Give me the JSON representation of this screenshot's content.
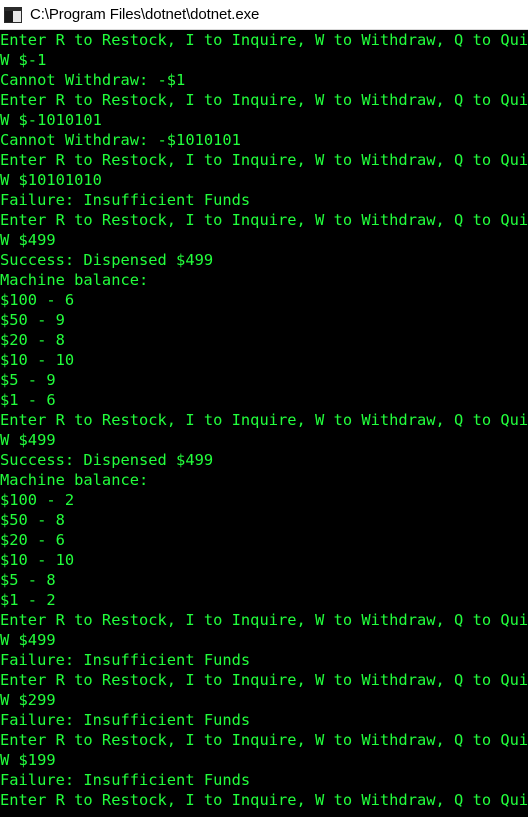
{
  "window": {
    "title": "C:\\Program Files\\dotnet\\dotnet.exe",
    "icon": "console-app-icon",
    "text_color": "#22ff3c",
    "background_color": "#000000"
  },
  "console": {
    "lines": [
      "Enter R to Restock, I to Inquire, W to Withdraw, Q to Quit",
      "W $-1",
      "Cannot Withdraw: -$1",
      "Enter R to Restock, I to Inquire, W to Withdraw, Q to Quit",
      "W $-1010101",
      "Cannot Withdraw: -$1010101",
      "Enter R to Restock, I to Inquire, W to Withdraw, Q to Quit",
      "W $10101010",
      "Failure: Insufficient Funds",
      "Enter R to Restock, I to Inquire, W to Withdraw, Q to Quit",
      "W $499",
      "Success: Dispensed $499",
      "Machine balance:",
      "$100 - 6",
      "$50 - 9",
      "$20 - 8",
      "$10 - 10",
      "$5 - 9",
      "$1 - 6",
      "Enter R to Restock, I to Inquire, W to Withdraw, Q to Quit",
      "W $499",
      "Success: Dispensed $499",
      "Machine balance:",
      "$100 - 2",
      "$50 - 8",
      "$20 - 6",
      "$10 - 10",
      "$5 - 8",
      "$1 - 2",
      "Enter R to Restock, I to Inquire, W to Withdraw, Q to Quit",
      "W $499",
      "Failure: Insufficient Funds",
      "Enter R to Restock, I to Inquire, W to Withdraw, Q to Quit",
      "W $299",
      "Failure: Insufficient Funds",
      "Enter R to Restock, I to Inquire, W to Withdraw, Q to Quit",
      "W $199",
      "Failure: Insufficient Funds",
      "Enter R to Restock, I to Inquire, W to Withdraw, Q to Quit"
    ]
  }
}
